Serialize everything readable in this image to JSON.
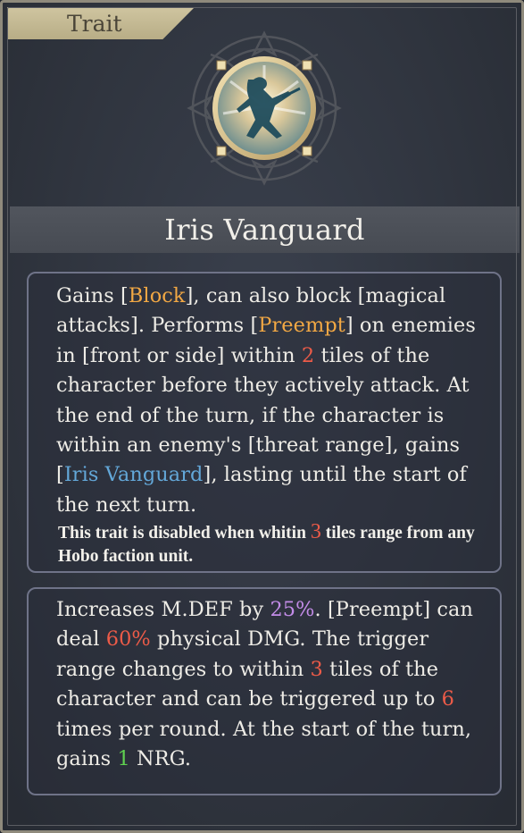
{
  "tab_label": "Trait",
  "title": "Iris Vanguard",
  "emblem_icon": "leaping-warrior-icon",
  "colors": {
    "keyword": "#f2a844",
    "number": "#ec5b48",
    "buff": "#63a7d8",
    "percent_purple": "#c38ce8",
    "nrg_green": "#5fd150"
  },
  "box1": {
    "p1": "Gains [",
    "block": "Block",
    "p2": "], can also block [magical attacks]. Performs [",
    "preempt": "Preempt",
    "p3": "] on enemies in [front or side] within ",
    "tiles": "2",
    "p4": " tiles of the character before they actively attack. At the end of the turn, if the character is within an enemy's [threat range], gains [",
    "buff": "Iris Vanguard",
    "p5": "], lasting until the start of the next turn.",
    "note_a": "This trait is disabled when whitin ",
    "note_num": "3",
    "note_b": " tiles range from any Hobo faction unit."
  },
  "box2": {
    "p1": "Increases M.DEF by ",
    "mdef": "25%",
    "p2": ". [Preempt] can deal ",
    "dmg": "60%",
    "p3": " physical DMG. The trigger range changes to within ",
    "range": "3",
    "p4": " tiles of the character and can be triggered up to ",
    "times": "6",
    "p5": " times per round. At the start of the turn, gains ",
    "nrg": "1",
    "p6": " NRG."
  }
}
